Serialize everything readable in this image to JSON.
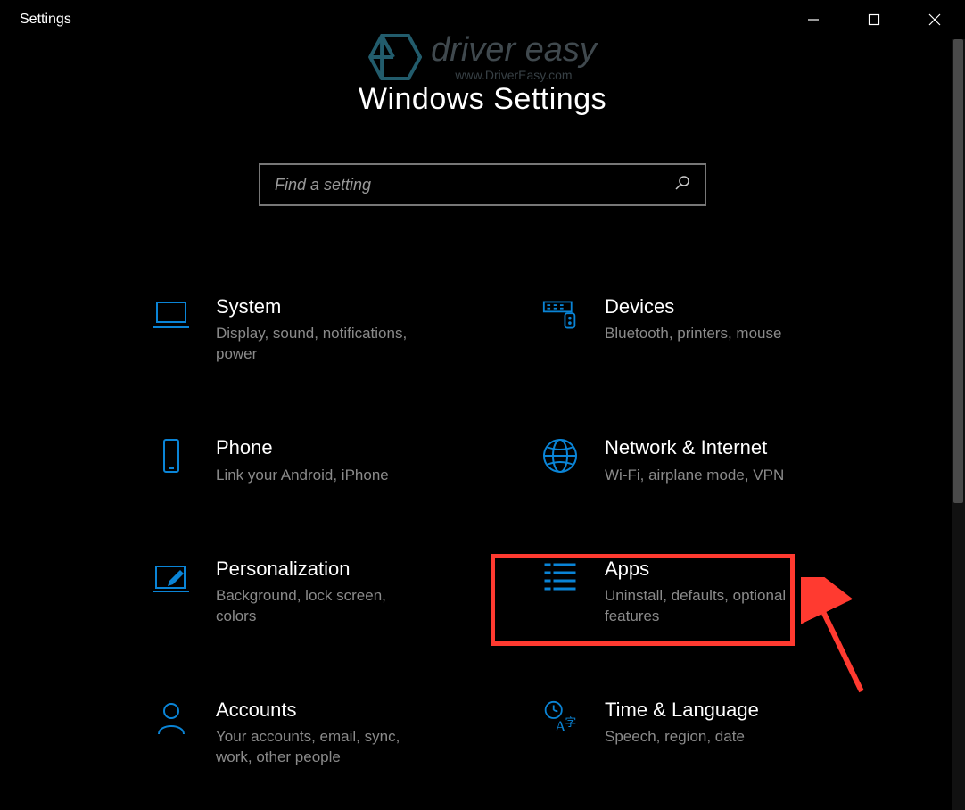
{
  "window": {
    "title": "Settings"
  },
  "watermark": {
    "brand": "driver easy",
    "url": "www.DriverEasy.com"
  },
  "page": {
    "title": "Windows Settings"
  },
  "search": {
    "placeholder": "Find a setting"
  },
  "colors": {
    "accent": "#0a84d6",
    "highlight": "#ff3a30"
  },
  "categories": [
    {
      "id": "system",
      "title": "System",
      "subtitle": "Display, sound, notifications, power"
    },
    {
      "id": "devices",
      "title": "Devices",
      "subtitle": "Bluetooth, printers, mouse"
    },
    {
      "id": "phone",
      "title": "Phone",
      "subtitle": "Link your Android, iPhone"
    },
    {
      "id": "network",
      "title": "Network & Internet",
      "subtitle": "Wi-Fi, airplane mode, VPN"
    },
    {
      "id": "personalization",
      "title": "Personalization",
      "subtitle": "Background, lock screen, colors"
    },
    {
      "id": "apps",
      "title": "Apps",
      "subtitle": "Uninstall, defaults, optional features",
      "highlighted": true
    },
    {
      "id": "accounts",
      "title": "Accounts",
      "subtitle": "Your accounts, email, sync, work, other people"
    },
    {
      "id": "time-language",
      "title": "Time & Language",
      "subtitle": "Speech, region, date"
    }
  ]
}
